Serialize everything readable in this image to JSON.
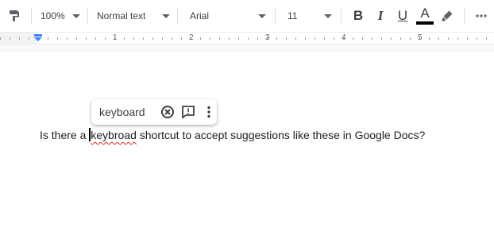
{
  "toolbar": {
    "zoom": "100%",
    "paragraph_style": "Normal text",
    "font_family": "Arial",
    "font_size": "11",
    "bold_label": "B",
    "italic_label": "I",
    "underline_label": "U",
    "text_color_label": "A",
    "text_color": "#000000"
  },
  "ruler": {
    "numbers": [
      "1",
      "2",
      "3",
      "4",
      "5"
    ]
  },
  "document": {
    "before": "Is there a ",
    "misspelled": "keybroad",
    "after": " shortcut to accept suggestions like these in Google Docs?"
  },
  "suggestion": {
    "word": "keyboard"
  }
}
